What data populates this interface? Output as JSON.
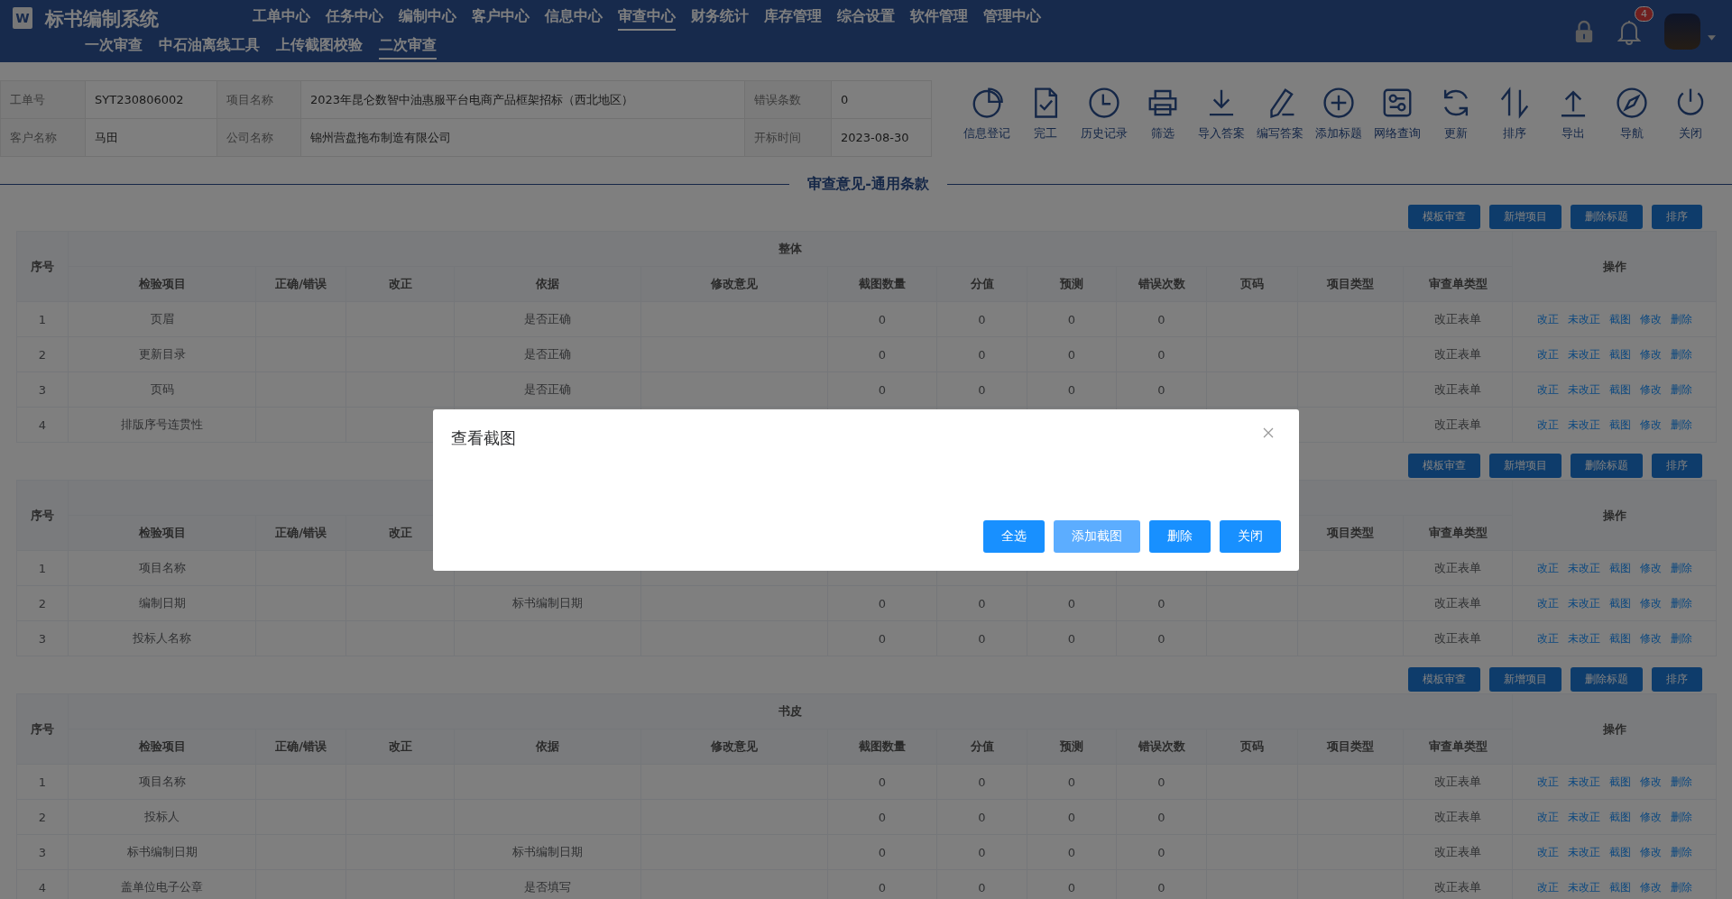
{
  "header": {
    "logo_text": "W",
    "title": "标书编制系统",
    "notification_count": "4",
    "main_nav": [
      {
        "label": "工单中心",
        "selected": false
      },
      {
        "label": "任务中心",
        "selected": false
      },
      {
        "label": "编制中心",
        "selected": false
      },
      {
        "label": "客户中心",
        "selected": false
      },
      {
        "label": "信息中心",
        "selected": false
      },
      {
        "label": "审查中心",
        "selected": true
      },
      {
        "label": "财务统计",
        "selected": false
      },
      {
        "label": "库存管理",
        "selected": false
      },
      {
        "label": "综合设置",
        "selected": false
      },
      {
        "label": "软件管理",
        "selected": false
      },
      {
        "label": "管理中心",
        "selected": false
      }
    ],
    "sub_nav": [
      {
        "label": "一次审查",
        "selected": false
      },
      {
        "label": "中石油离线工具",
        "selected": false
      },
      {
        "label": "上传截图校验",
        "selected": false
      },
      {
        "label": "二次审查",
        "selected": true
      }
    ]
  },
  "info": [
    {
      "cells": [
        {
          "label": "工单号",
          "value": "SYT230806002"
        },
        {
          "label": "项目名称",
          "value": "2023年昆仑数智中油惠服平台电商产品框架招标（西北地区）"
        },
        {
          "label": "错误条数",
          "value": "0"
        }
      ]
    },
    {
      "cells": [
        {
          "label": "客户名称",
          "value": "马田"
        },
        {
          "label": "公司名称",
          "value": "锦州营盘拖布制造有限公司"
        },
        {
          "label": "开标时间",
          "value": "2023-08-30"
        }
      ]
    }
  ],
  "toolbar": [
    {
      "kind": "pie",
      "label": "信息登记"
    },
    {
      "kind": "file-check",
      "label": "完工"
    },
    {
      "kind": "clock",
      "label": "历史记录"
    },
    {
      "kind": "printer",
      "label": "筛选"
    },
    {
      "kind": "download",
      "label": "导入答案"
    },
    {
      "kind": "pencil",
      "label": "编写答案"
    },
    {
      "kind": "plus-circle",
      "label": "添加标题"
    },
    {
      "kind": "sliders",
      "label": "网络查询"
    },
    {
      "kind": "refresh",
      "label": "更新"
    },
    {
      "kind": "sort",
      "label": "排序"
    },
    {
      "kind": "upload",
      "label": "导出"
    },
    {
      "kind": "compass",
      "label": "导航"
    },
    {
      "kind": "power",
      "label": "关闭"
    }
  ],
  "section_title": "审查意见-通用条款",
  "sections": [
    {
      "buttons": [
        "模板审查",
        "新增项目",
        "删除标题",
        "排序"
      ],
      "group_title": "整体",
      "columns": {
        "no": "序号",
        "item": "检验项目",
        "correct": "正确/错误",
        "fix": "改正",
        "basis": "依据",
        "opinion": "修改意见",
        "shots": "截图数量",
        "score": "分值",
        "predict": "预测",
        "errors": "错误次数",
        "page": "页码",
        "item_type": "项目类型",
        "form_type": "审查单类型",
        "actions": "操作"
      },
      "rows": [
        {
          "no": "1",
          "item": "页眉",
          "basis": "是否正确",
          "shots": "0",
          "score": "0",
          "predict": "0",
          "errors": "0",
          "form_type": "改正表单",
          "actions": [
            "改正",
            "未改正",
            "截图",
            "修改",
            "删除"
          ]
        },
        {
          "no": "2",
          "item": "更新目录",
          "basis": "是否正确",
          "shots": "0",
          "score": "0",
          "predict": "0",
          "errors": "0",
          "form_type": "改正表单",
          "actions": [
            "改正",
            "未改正",
            "截图",
            "修改",
            "删除"
          ]
        },
        {
          "no": "3",
          "item": "页码",
          "basis": "是否正确",
          "shots": "0",
          "score": "0",
          "predict": "0",
          "errors": "0",
          "form_type": "改正表单",
          "actions": [
            "改正",
            "未改正",
            "截图",
            "修改",
            "删除"
          ]
        },
        {
          "no": "4",
          "item": "排版序号连贯性",
          "form_type": "改正表单",
          "actions": [
            "改正",
            "未改正",
            "截图",
            "修改",
            "删除"
          ]
        }
      ]
    },
    {
      "buttons": [
        "模板审查",
        "新增项目",
        "删除标题",
        "排序"
      ],
      "columns": {
        "no": "序号",
        "item": "检验项目",
        "correct": "正确/错误",
        "fix": "改正",
        "item_type": "项目类型",
        "form_type": "审查单类型",
        "actions": "操作"
      },
      "rows": [
        {
          "no": "1",
          "item": "项目名称",
          "form_type": "改正表单",
          "actions": [
            "改正",
            "未改正",
            "截图",
            "修改",
            "删除"
          ]
        },
        {
          "no": "2",
          "item": "编制日期",
          "basis": "标书编制日期",
          "shots": "0",
          "score": "0",
          "predict": "0",
          "errors": "0",
          "form_type": "改正表单",
          "actions": [
            "改正",
            "未改正",
            "截图",
            "修改",
            "删除"
          ]
        },
        {
          "no": "3",
          "item": "投标人名称",
          "shots": "0",
          "score": "0",
          "predict": "0",
          "errors": "0",
          "form_type": "改正表单",
          "actions": [
            "改正",
            "未改正",
            "截图",
            "修改",
            "删除"
          ]
        }
      ]
    },
    {
      "buttons": [
        "模板审查",
        "新增项目",
        "删除标题",
        "排序"
      ],
      "group_title": "书皮",
      "columns": {
        "no": "序号",
        "item": "检验项目",
        "correct": "正确/错误",
        "fix": "改正",
        "basis": "依据",
        "opinion": "修改意见",
        "shots": "截图数量",
        "score": "分值",
        "predict": "预测",
        "errors": "错误次数",
        "page": "页码",
        "item_type": "项目类型",
        "form_type": "审查单类型",
        "actions": "操作"
      },
      "rows": [
        {
          "no": "1",
          "item": "项目名称",
          "shots": "0",
          "score": "0",
          "predict": "0",
          "errors": "0",
          "form_type": "改正表单",
          "actions": [
            "改正",
            "未改正",
            "截图",
            "修改",
            "删除"
          ]
        },
        {
          "no": "2",
          "item": "投标人",
          "shots": "0",
          "score": "0",
          "predict": "0",
          "errors": "0",
          "form_type": "改正表单",
          "actions": [
            "改正",
            "未改正",
            "截图",
            "修改",
            "删除"
          ]
        },
        {
          "no": "3",
          "item": "标书编制日期",
          "basis": "标书编制日期",
          "shots": "0",
          "score": "0",
          "predict": "0",
          "errors": "0",
          "form_type": "改正表单",
          "actions": [
            "改正",
            "未改正",
            "截图",
            "修改",
            "删除"
          ]
        },
        {
          "no": "4",
          "item": "盖单位电子公章",
          "basis": "是否填写",
          "shots": "0",
          "score": "0",
          "predict": "0",
          "errors": "0",
          "form_type": "改正表单",
          "actions": [
            "改正",
            "未改正",
            "截图",
            "修改",
            "删除"
          ]
        }
      ]
    }
  ],
  "modal": {
    "title": "查看截图",
    "buttons": [
      {
        "label": "全选",
        "disabled": false
      },
      {
        "label": "添加截图",
        "disabled": true
      },
      {
        "label": "删除",
        "disabled": false
      },
      {
        "label": "关闭",
        "disabled": false
      }
    ]
  }
}
